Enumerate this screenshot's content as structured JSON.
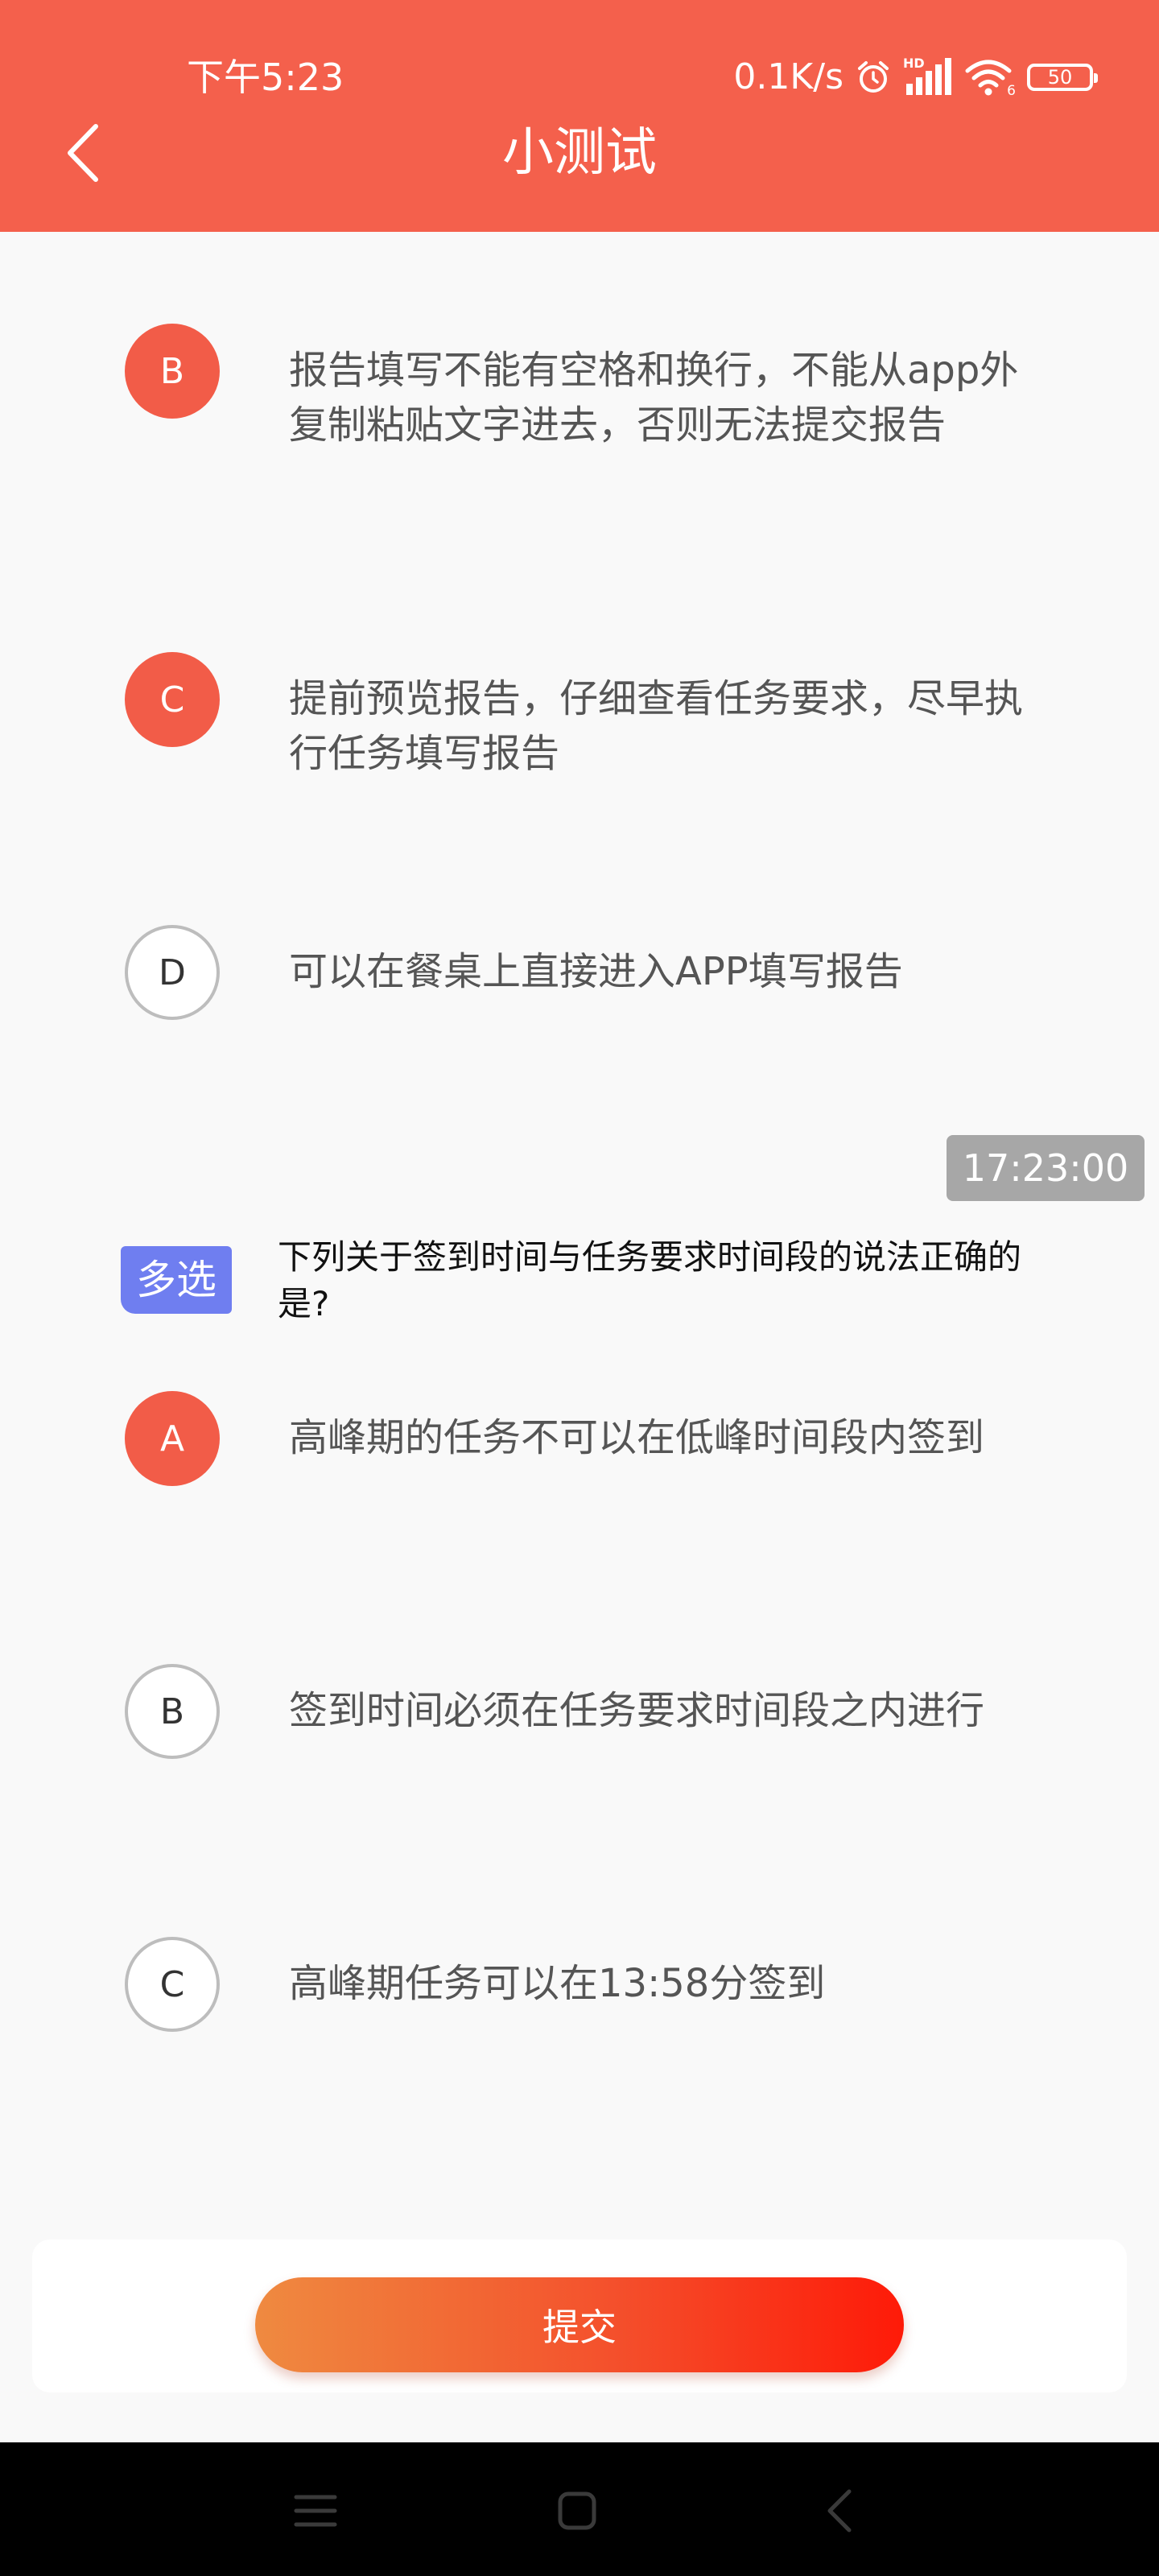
{
  "status_bar": {
    "time": "下午5:23",
    "net_speed": "0.1K/s",
    "hd_label": "HD",
    "signal_sub": "6",
    "battery": "50"
  },
  "header": {
    "title": "小测试"
  },
  "question_prev": {
    "options": [
      {
        "letter": "B",
        "text": "报告填写不能有空格和换行，不能从app外复制粘贴文字进去，否则无法提交报告",
        "selected": true
      },
      {
        "letter": "C",
        "text": "提前预览报告，仔细查看任务要求，尽早执行任务填写报告",
        "selected": true
      },
      {
        "letter": "D",
        "text": "可以在餐桌上直接进入APP填写报告",
        "selected": false
      }
    ]
  },
  "timestamp": "17:23:00",
  "question": {
    "tag": "多选",
    "text": "下列关于签到时间与任务要求时间段的说法正确的是?",
    "options": [
      {
        "letter": "A",
        "text": "高峰期的任务不可以在低峰时间段内签到",
        "selected": true
      },
      {
        "letter": "B",
        "text": "签到时间必须在任务要求时间段之内进行",
        "selected": false
      },
      {
        "letter": "C",
        "text": "高峰期任务可以在13:58分签到",
        "selected": false
      }
    ]
  },
  "submit": {
    "label": "提交"
  },
  "colors": {
    "header": "#f4604c",
    "selected": "#f25c48",
    "tag": "#6f7ef0",
    "timestamp": "#a7a7a7"
  }
}
